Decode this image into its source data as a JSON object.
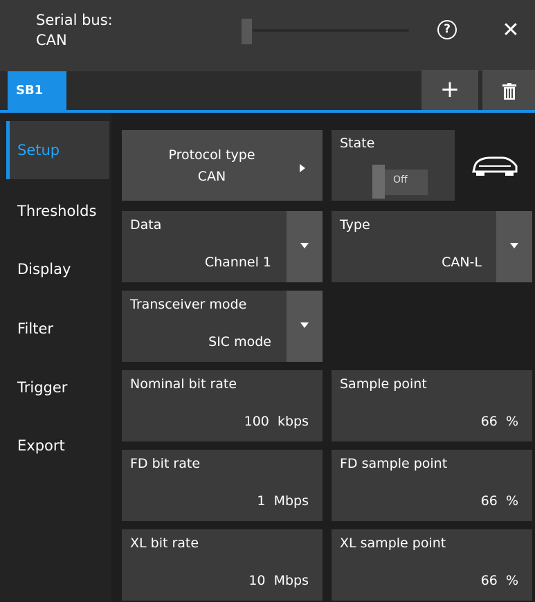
{
  "window": {
    "title_line1": "Serial bus:",
    "title_line2": "CAN",
    "help_label": "?",
    "close_label": "✕"
  },
  "tabs": {
    "active_label": "SB1",
    "add_label": "+"
  },
  "sidebar": {
    "items": [
      {
        "label": "Setup",
        "active": true
      },
      {
        "label": "Thresholds",
        "active": false
      },
      {
        "label": "Display",
        "active": false
      },
      {
        "label": "Filter",
        "active": false
      },
      {
        "label": "Trigger",
        "active": false
      },
      {
        "label": "Export",
        "active": false
      }
    ]
  },
  "setup": {
    "protocol_type": {
      "label": "Protocol type",
      "value": "CAN"
    },
    "state": {
      "label": "State",
      "toggle_label": "Off"
    },
    "data": {
      "label": "Data",
      "value": "Channel 1"
    },
    "type": {
      "label": "Type",
      "value": "CAN-L"
    },
    "transceiver_mode": {
      "label": "Transceiver mode",
      "value": "SIC mode"
    },
    "nominal_bit_rate": {
      "label": "Nominal bit rate",
      "value": "100  kbps"
    },
    "sample_point": {
      "label": "Sample point",
      "value": "66  %"
    },
    "fd_bit_rate": {
      "label": "FD bit rate",
      "value": "1  Mbps"
    },
    "fd_sample_point": {
      "label": "FD sample point",
      "value": "66  %"
    },
    "xl_bit_rate": {
      "label": "XL bit rate",
      "value": "10  Mbps"
    },
    "xl_sample_point": {
      "label": "XL sample point",
      "value": "66  %"
    }
  },
  "icons": {
    "car": "car-icon",
    "help": "help-icon",
    "close": "close-icon",
    "trash": "trash-icon"
  },
  "colors": {
    "accent": "#1a8fe6",
    "active_text": "#22a5ff"
  }
}
